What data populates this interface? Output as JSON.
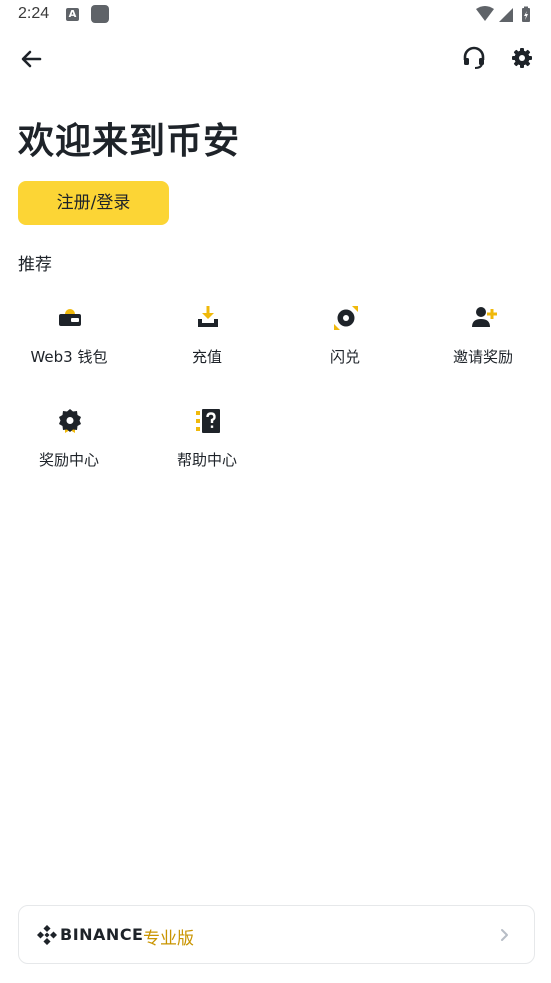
{
  "status_bar": {
    "time": "2:24",
    "a_badge": "A"
  },
  "header": {
    "title": "欢迎来到币安"
  },
  "login": {
    "label": "注册/登录"
  },
  "recommend": {
    "heading": "推荐",
    "items": [
      {
        "label": "Web3 钱包",
        "icon": "web3-wallet-icon"
      },
      {
        "label": "充值",
        "icon": "deposit-icon"
      },
      {
        "label": "闪兑",
        "icon": "convert-icon"
      },
      {
        "label": "邀请奖励",
        "icon": "invite-user-icon"
      },
      {
        "label": "奖励中心",
        "icon": "reward-badge-icon"
      },
      {
        "label": "帮助中心",
        "icon": "help-center-icon"
      }
    ]
  },
  "pro_banner": {
    "brand": "BINANCE",
    "suffix": "专业版"
  },
  "colors": {
    "accent": "#fcd535",
    "accent_text": "#c99400",
    "text": "#1e2329"
  }
}
